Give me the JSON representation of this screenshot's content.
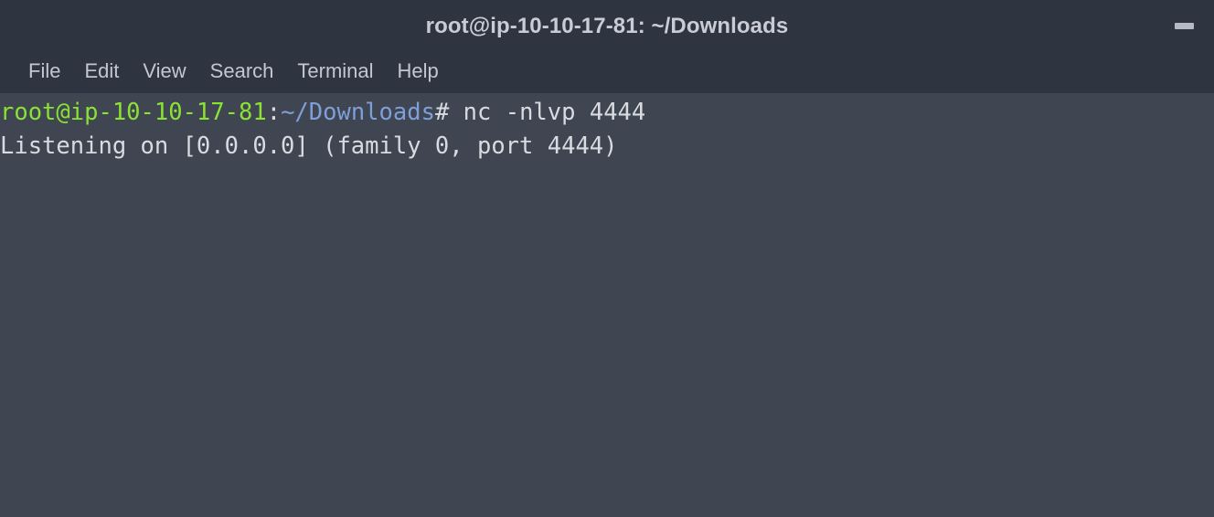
{
  "window": {
    "title": "root@ip-10-10-17-81: ~/Downloads",
    "minimize_label": "–",
    "titlebar_color": "#2f3441",
    "background_color": "#3f4551"
  },
  "menubar": {
    "items": [
      {
        "label": "File",
        "name": "menu-file"
      },
      {
        "label": "Edit",
        "name": "menu-edit"
      },
      {
        "label": "View",
        "name": "menu-view"
      },
      {
        "label": "Search",
        "name": "menu-search"
      },
      {
        "label": "Terminal",
        "name": "menu-terminal"
      },
      {
        "label": "Help",
        "name": "menu-help"
      }
    ]
  },
  "terminal": {
    "prompt": {
      "user_host": "root@ip-10-10-17-81",
      "separator": ":",
      "path": "~/Downloads",
      "symbol": "# ",
      "command": "nc -nlvp 4444"
    },
    "output_lines": [
      "Listening on [0.0.0.0] (family 0, port 4444)"
    ],
    "colors": {
      "user_host": "#8ae234",
      "path": "#7f9fd9",
      "text": "#d8dbe0"
    }
  }
}
